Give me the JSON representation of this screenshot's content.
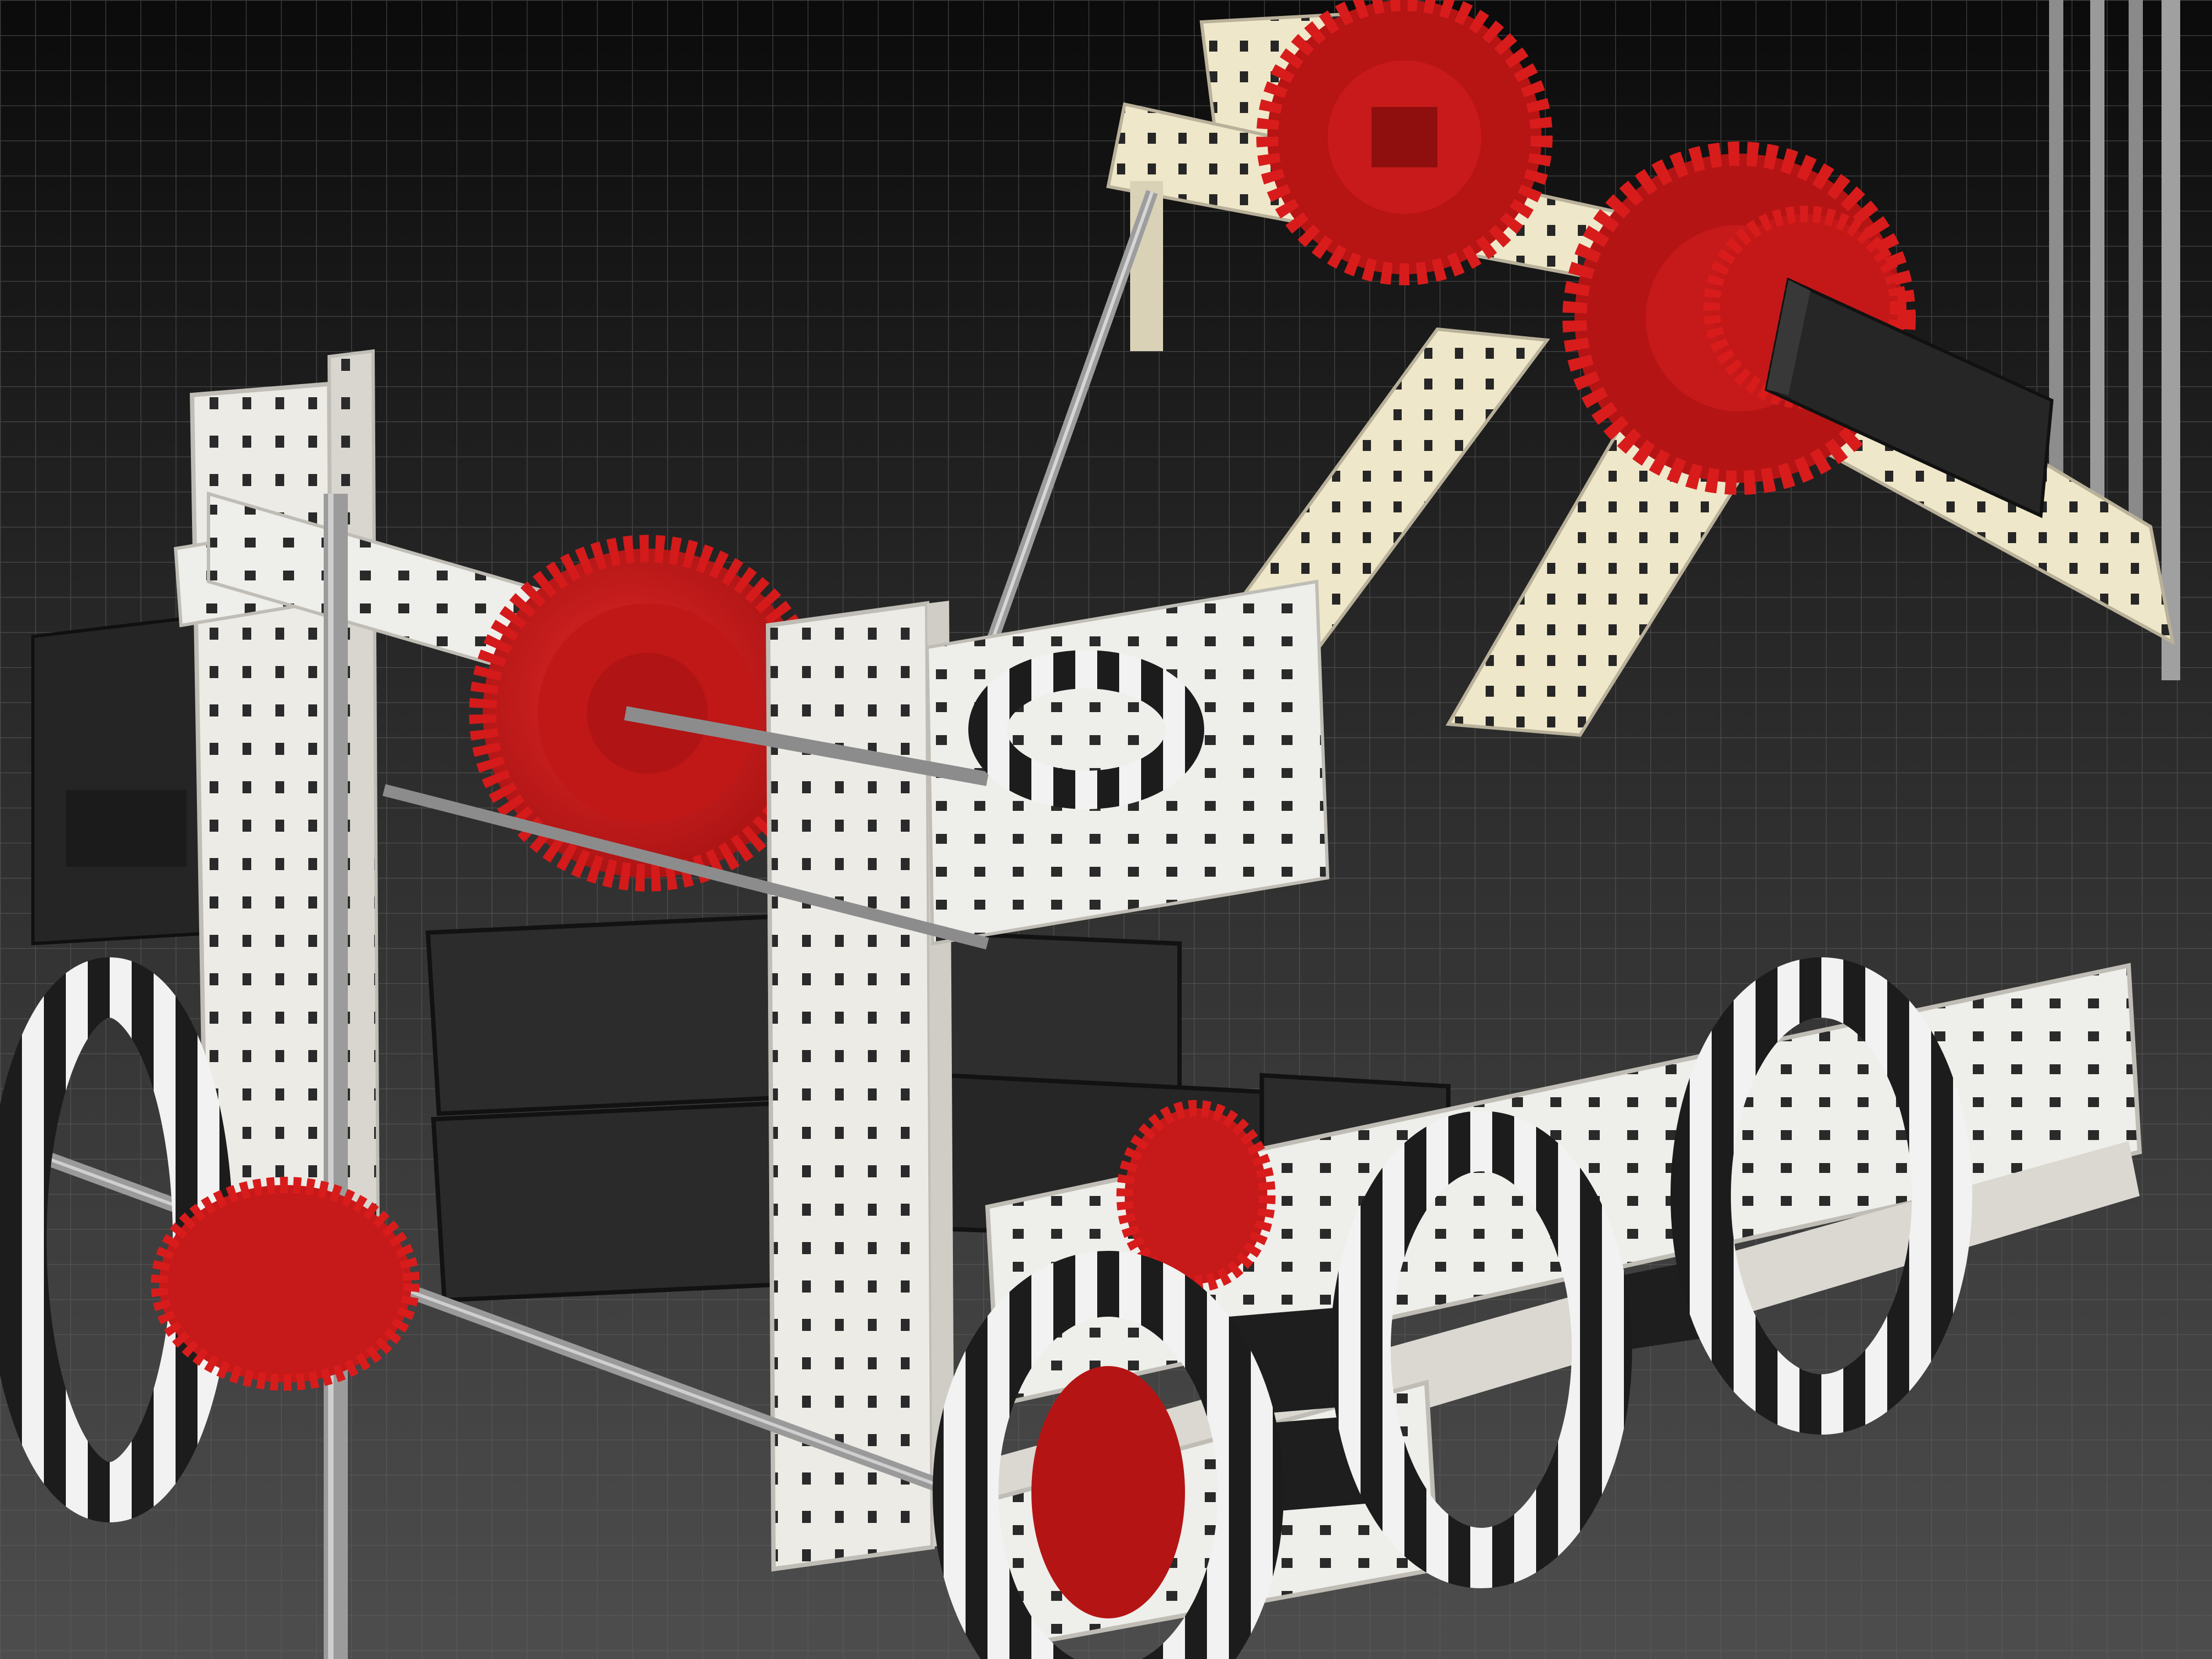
{
  "photo": {
    "subject": "cad-render-robot",
    "colors": {
      "background_top": "#0d0d0d",
      "background_bottom": "#4a4a4a",
      "grid": "#5c5c5c",
      "metal": "#ecebe6",
      "metal_warm": "#efe7c9",
      "metal_shade": "#c9c7c0",
      "hole": "#2a2a2a",
      "gear": "#d81c1c",
      "gear_dark": "#9e1010",
      "motor": "#2b2b2b",
      "motor_top": "#3a3a3a",
      "shaft": "#9a9a9a",
      "wheel_black": "#1c1c1c",
      "wheel_white": "#f2f2f2"
    }
  }
}
